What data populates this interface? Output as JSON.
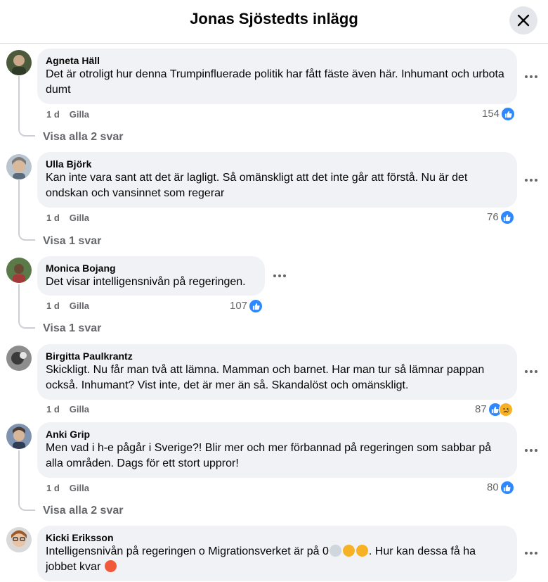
{
  "header": {
    "title": "Jonas Sjöstedts inlägg"
  },
  "comments": [
    {
      "author": "Agneta Häll",
      "text": "Det är otroligt hur denna Trumpinfluerade politik har fått fäste även här. Inhumant och urbota dumt",
      "time": "1 d",
      "like_label": "Gilla",
      "reaction_count": "154",
      "replies_label": "Visa alla 2 svar"
    },
    {
      "author": "Ulla Björk",
      "text": "Kan inte vara sant att det är lagligt. Så omänskligt att det inte går att förstå. Nu är det ondskan och vansinnet som regerar",
      "time": "1 d",
      "like_label": "Gilla",
      "reaction_count": "76",
      "replies_label": "Visa 1 svar"
    },
    {
      "author": "Monica Bojang",
      "text": "Det visar intelligensnivån på regeringen.",
      "time": "1 d",
      "like_label": "Gilla",
      "reaction_count": "107",
      "replies_label": "Visa 1 svar"
    },
    {
      "author": "Birgitta Paulkrantz",
      "text": "Skickligt. Nu får man två att lämna. Mamman och barnet. Har man tur så lämnar pappan också. Inhumant? Vist inte, det är mer än så. Skandalöst och omänskligt.",
      "time": "1 d",
      "like_label": "Gilla",
      "reaction_count": "87"
    },
    {
      "author": "Anki Grip",
      "text": "Men vad i h-e pågår i Sverige?! Blir mer och mer förbannad på regeringen som sabbar på alla områden. Dags för ett stort uppror!",
      "time": "1 d",
      "like_label": "Gilla",
      "reaction_count": "80",
      "replies_label": "Visa alla 2 svar"
    },
    {
      "author": "Kicki Eriksson",
      "text_part1": "Intelligensnivån på regeringen o Migrationsverket är på 0",
      "text_part2": ". Hur kan dessa få ha jobbet kvar "
    }
  ],
  "colors": {
    "bubble": "#f0f2f5",
    "meta": "#65676b",
    "like": "#2d88ff",
    "sad": "#f7b125"
  },
  "icons": {
    "close": "close-icon",
    "more": "more-options-icon",
    "like": "like-reaction-icon",
    "sad": "sad-reaction-icon"
  }
}
